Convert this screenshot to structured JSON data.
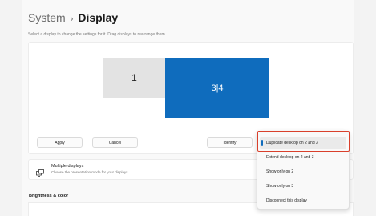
{
  "breadcrumb": {
    "parent": "System",
    "separator": "›",
    "current": "Display"
  },
  "subtitle": "Select a display to change the settings for it. Drag displays to rearrange them.",
  "monitors": [
    {
      "label": "1"
    },
    {
      "label": "3|4"
    }
  ],
  "buttons": {
    "apply": "Apply",
    "cancel": "Cancel",
    "identify": "Identify"
  },
  "multiple_displays": {
    "title": "Multiple displays",
    "description": "Choose the presentation mode for your displays"
  },
  "section_heading": "Brightness & color",
  "dropdown": {
    "options": [
      {
        "label": "Duplicate desktop on 2 and 3",
        "selected": true
      },
      {
        "label": "Extend desktop on 2 and 3",
        "selected": false
      },
      {
        "label": "Show only on 2",
        "selected": false
      },
      {
        "label": "Show only on 3",
        "selected": false
      },
      {
        "label": "Disconnect this display",
        "selected": false
      }
    ]
  },
  "colors": {
    "accent": "#0f6cbd",
    "highlight": "#d9402c",
    "secondary_monitor": "#e3e3e3"
  },
  "icons": {
    "multiple_displays": "multiple-displays-icon"
  }
}
